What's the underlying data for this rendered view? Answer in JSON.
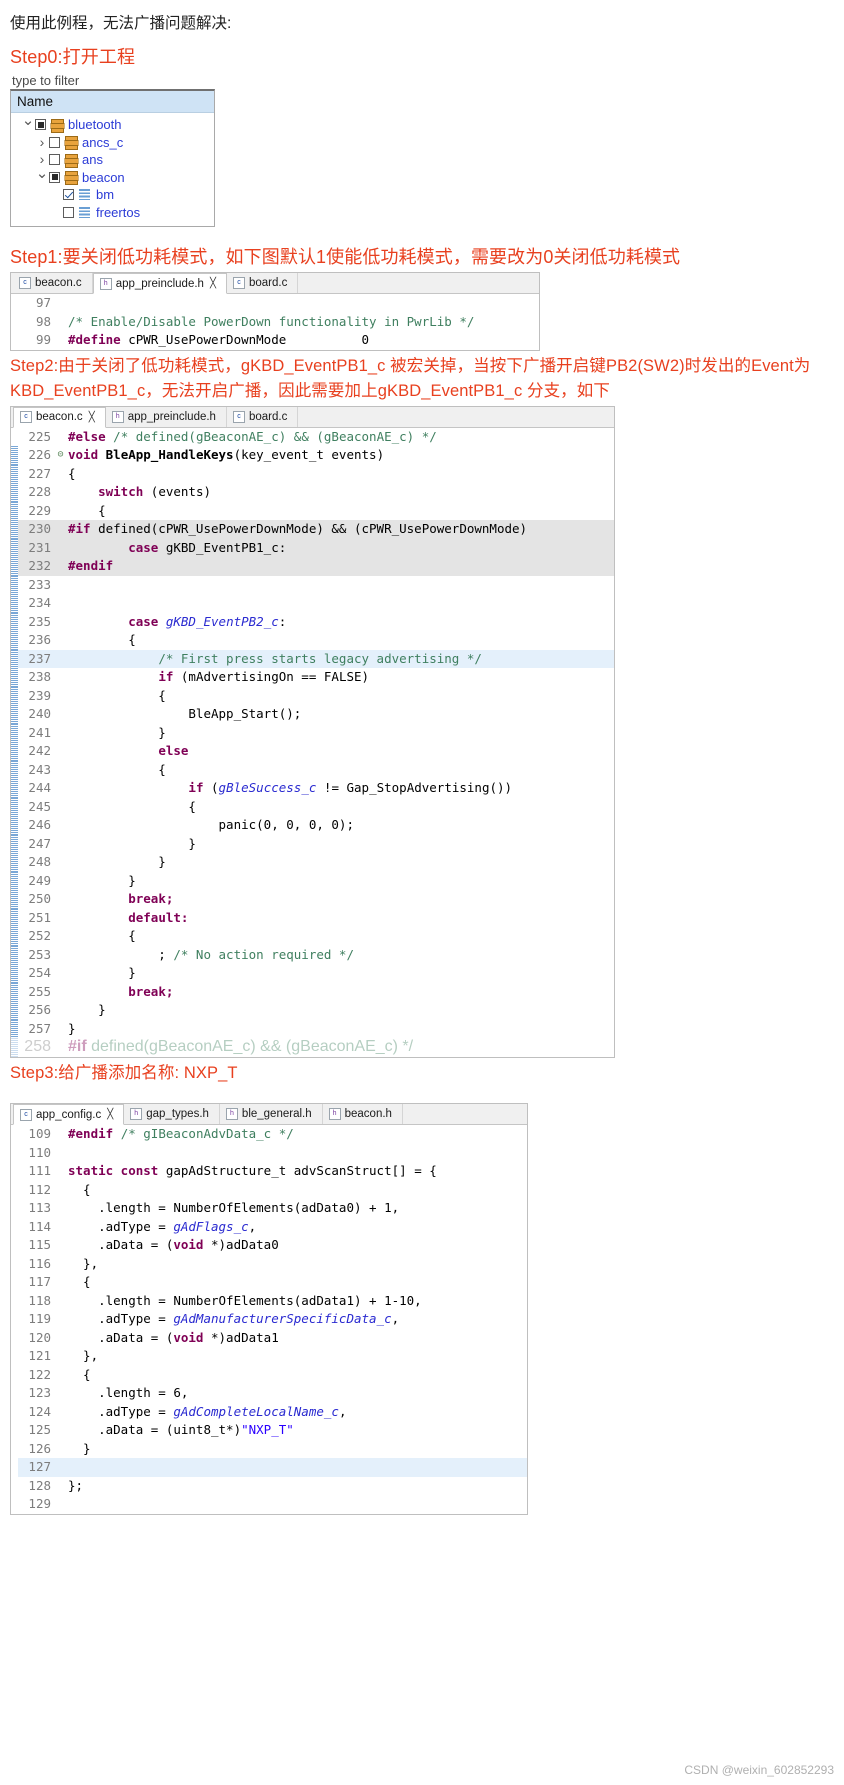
{
  "intro": "使用此例程，无法广播问题解决:",
  "steps": {
    "step0": "Step0:打开工程",
    "step1": "Step1:要关闭低功耗模式，如下图默认1使能低功耗模式，需要改为0关闭低功耗模式",
    "step2_line1": "Step2:由于关闭了低功耗模式，gKBD_EventPB1_c 被宏关掉，当按下广播开启键PB2(SW2)时发出的Event为",
    "step2_line2": "KBD_EventPB1_c，无法开启广播，因此需要加上gKBD_EventPB1_c 分支，如下",
    "step3": "Step3:给广播添加名称: NXP_T"
  },
  "project_tree": {
    "filter_placeholder": "type to filter",
    "column_header": "Name",
    "items": [
      {
        "label": "bluetooth",
        "indent": 0,
        "arrow": "down",
        "check": "filled",
        "icon": "project-icon"
      },
      {
        "label": "ancs_c",
        "indent": 1,
        "arrow": "right",
        "check": "empty",
        "icon": "project-icon"
      },
      {
        "label": "ans",
        "indent": 1,
        "arrow": "right",
        "check": "empty",
        "icon": "project-icon"
      },
      {
        "label": "beacon",
        "indent": 1,
        "arrow": "down",
        "check": "filled",
        "icon": "project-icon"
      },
      {
        "label": "bm",
        "indent": 2,
        "arrow": "none",
        "check": "checked",
        "icon": "file-icon"
      },
      {
        "label": "freertos",
        "indent": 2,
        "arrow": "none",
        "check": "empty",
        "icon": "file-icon"
      }
    ]
  },
  "editor1": {
    "tabs": [
      {
        "label": "beacon.c",
        "icon": "c-file-icon",
        "active": false,
        "closable": false
      },
      {
        "label": "app_preinclude.h",
        "icon": "h-file-icon",
        "active": true,
        "closable": true
      },
      {
        "label": "board.c",
        "icon": "c-file-icon",
        "active": false,
        "closable": false
      }
    ],
    "lines": [
      {
        "no": "97",
        "fold": "",
        "hl": "",
        "tokens": []
      },
      {
        "no": "98",
        "fold": "",
        "hl": "",
        "tokens": [
          {
            "t": "/* Enable/Disable PowerDown functionality in PwrLib */",
            "c": "cmt"
          }
        ]
      },
      {
        "no": "99",
        "fold": "",
        "hl": "",
        "tokens": [
          {
            "t": "#define",
            "c": "pp"
          },
          {
            "t": " cPWR_UsePowerDownMode          0",
            "c": "plain"
          }
        ]
      }
    ]
  },
  "editor2": {
    "tabs": [
      {
        "label": "beacon.c",
        "icon": "c-file-icon",
        "active": true,
        "closable": true
      },
      {
        "label": "app_preinclude.h",
        "icon": "h-file-icon",
        "active": false,
        "closable": false
      },
      {
        "label": "board.c",
        "icon": "c-file-icon",
        "active": false,
        "closable": false
      }
    ],
    "lines": [
      {
        "no": "225",
        "fold": "",
        "hl": "",
        "marked": false,
        "tokens": [
          {
            "t": "#else",
            "c": "pp"
          },
          {
            "t": " ",
            "c": "plain"
          },
          {
            "t": "/* defined(gBeaconAE_c) && (gBeaconAE_c) */",
            "c": "cmt"
          }
        ]
      },
      {
        "no": "226",
        "fold": "-",
        "hl": "",
        "marked": true,
        "tokens": [
          {
            "t": "void ",
            "c": "kw"
          },
          {
            "t": "BleApp_HandleKeys",
            "c": "fn"
          },
          {
            "t": "(key_event_t events)",
            "c": "plain"
          }
        ]
      },
      {
        "no": "227",
        "fold": "",
        "hl": "",
        "marked": true,
        "tokens": [
          {
            "t": "{",
            "c": "plain"
          }
        ]
      },
      {
        "no": "228",
        "fold": "",
        "hl": "",
        "marked": true,
        "tokens": [
          {
            "t": "    ",
            "c": "plain"
          },
          {
            "t": "switch",
            "c": "kw"
          },
          {
            "t": " (events)",
            "c": "plain"
          }
        ]
      },
      {
        "no": "229",
        "fold": "",
        "hl": "",
        "marked": true,
        "tokens": [
          {
            "t": "    {",
            "c": "plain"
          }
        ]
      },
      {
        "no": "230",
        "fold": "",
        "hl": "hl-grey",
        "marked": true,
        "tokens": [
          {
            "t": "#if",
            "c": "pp"
          },
          {
            "t": " defined(cPWR_UsePowerDownMode) && (cPWR_UsePowerDownMode)",
            "c": "plain"
          }
        ]
      },
      {
        "no": "231",
        "fold": "",
        "hl": "hl-grey",
        "marked": true,
        "tokens": [
          {
            "t": "        ",
            "c": "plain"
          },
          {
            "t": "case",
            "c": "kw"
          },
          {
            "t": " gKBD_EventPB1_c:",
            "c": "plain"
          }
        ]
      },
      {
        "no": "232",
        "fold": "",
        "hl": "hl-grey",
        "marked": true,
        "tokens": [
          {
            "t": "#endif",
            "c": "pp"
          }
        ]
      },
      {
        "no": "233",
        "fold": "",
        "hl": "",
        "marked": true,
        "tokens": []
      },
      {
        "no": "234",
        "fold": "",
        "hl": "",
        "marked": true,
        "tokens": []
      },
      {
        "no": "235",
        "fold": "",
        "hl": "",
        "marked": true,
        "tokens": [
          {
            "t": "        ",
            "c": "plain"
          },
          {
            "t": "case",
            "c": "kw"
          },
          {
            "t": " ",
            "c": "plain"
          },
          {
            "t": "gKBD_EventPB2_c",
            "c": "ital"
          },
          {
            "t": ":",
            "c": "plain"
          }
        ]
      },
      {
        "no": "236",
        "fold": "",
        "hl": "",
        "marked": true,
        "tokens": [
          {
            "t": "        {",
            "c": "plain"
          }
        ]
      },
      {
        "no": "237",
        "fold": "",
        "hl": "hl-blue",
        "marked": true,
        "tokens": [
          {
            "t": "            ",
            "c": "plain"
          },
          {
            "t": "/* First press starts legacy advertising */",
            "c": "cmt"
          }
        ]
      },
      {
        "no": "238",
        "fold": "",
        "hl": "",
        "marked": true,
        "tokens": [
          {
            "t": "            ",
            "c": "plain"
          },
          {
            "t": "if",
            "c": "kw"
          },
          {
            "t": " (mAdvertisingOn == FALSE)",
            "c": "plain"
          }
        ]
      },
      {
        "no": "239",
        "fold": "",
        "hl": "",
        "marked": true,
        "tokens": [
          {
            "t": "            {",
            "c": "plain"
          }
        ]
      },
      {
        "no": "240",
        "fold": "",
        "hl": "",
        "marked": true,
        "tokens": [
          {
            "t": "                BleApp_Start();",
            "c": "plain"
          }
        ]
      },
      {
        "no": "241",
        "fold": "",
        "hl": "",
        "marked": true,
        "tokens": [
          {
            "t": "            }",
            "c": "plain"
          }
        ]
      },
      {
        "no": "242",
        "fold": "",
        "hl": "",
        "marked": true,
        "tokens": [
          {
            "t": "            ",
            "c": "plain"
          },
          {
            "t": "else",
            "c": "kw"
          }
        ]
      },
      {
        "no": "243",
        "fold": "",
        "hl": "",
        "marked": true,
        "tokens": [
          {
            "t": "            {",
            "c": "plain"
          }
        ]
      },
      {
        "no": "244",
        "fold": "",
        "hl": "",
        "marked": true,
        "tokens": [
          {
            "t": "                ",
            "c": "plain"
          },
          {
            "t": "if",
            "c": "kw"
          },
          {
            "t": " (",
            "c": "plain"
          },
          {
            "t": "gBleSuccess_c",
            "c": "ital"
          },
          {
            "t": " != Gap_StopAdvertising())",
            "c": "plain"
          }
        ]
      },
      {
        "no": "245",
        "fold": "",
        "hl": "",
        "marked": true,
        "tokens": [
          {
            "t": "                {",
            "c": "plain"
          }
        ]
      },
      {
        "no": "246",
        "fold": "",
        "hl": "",
        "marked": true,
        "tokens": [
          {
            "t": "                    panic(0, 0, 0, 0);",
            "c": "plain"
          }
        ]
      },
      {
        "no": "247",
        "fold": "",
        "hl": "",
        "marked": true,
        "tokens": [
          {
            "t": "                }",
            "c": "plain"
          }
        ]
      },
      {
        "no": "248",
        "fold": "",
        "hl": "",
        "marked": true,
        "tokens": [
          {
            "t": "            }",
            "c": "plain"
          }
        ]
      },
      {
        "no": "249",
        "fold": "",
        "hl": "",
        "marked": true,
        "tokens": [
          {
            "t": "        }",
            "c": "plain"
          }
        ]
      },
      {
        "no": "250",
        "fold": "",
        "hl": "",
        "marked": true,
        "tokens": [
          {
            "t": "        ",
            "c": "plain"
          },
          {
            "t": "break;",
            "c": "kw"
          }
        ]
      },
      {
        "no": "251",
        "fold": "",
        "hl": "",
        "marked": true,
        "tokens": [
          {
            "t": "        ",
            "c": "plain"
          },
          {
            "t": "default:",
            "c": "kw"
          }
        ]
      },
      {
        "no": "252",
        "fold": "",
        "hl": "",
        "marked": true,
        "tokens": [
          {
            "t": "        {",
            "c": "plain"
          }
        ]
      },
      {
        "no": "253",
        "fold": "",
        "hl": "",
        "marked": true,
        "tokens": [
          {
            "t": "            ; ",
            "c": "plain"
          },
          {
            "t": "/* No action required */",
            "c": "cmt"
          }
        ]
      },
      {
        "no": "254",
        "fold": "",
        "hl": "",
        "marked": true,
        "tokens": [
          {
            "t": "        }",
            "c": "plain"
          }
        ]
      },
      {
        "no": "255",
        "fold": "",
        "hl": "",
        "marked": true,
        "tokens": [
          {
            "t": "        ",
            "c": "plain"
          },
          {
            "t": "break;",
            "c": "kw"
          }
        ]
      },
      {
        "no": "256",
        "fold": "",
        "hl": "",
        "marked": true,
        "tokens": [
          {
            "t": "    }",
            "c": "plain"
          }
        ]
      },
      {
        "no": "257",
        "fold": "",
        "hl": "",
        "marked": true,
        "tokens": [
          {
            "t": "}",
            "c": "plain"
          }
        ]
      }
    ]
  },
  "editor3": {
    "tabs": [
      {
        "label": "app_config.c",
        "icon": "c-file-icon",
        "active": true,
        "closable": true
      },
      {
        "label": "gap_types.h",
        "icon": "h-file-icon",
        "active": false,
        "closable": false
      },
      {
        "label": "ble_general.h",
        "icon": "h-file-icon",
        "active": false,
        "closable": false
      },
      {
        "label": "beacon.h",
        "icon": "h-file-icon",
        "active": false,
        "closable": false
      }
    ],
    "lines": [
      {
        "no": "109",
        "fold": "",
        "hl": "",
        "tokens": [
          {
            "t": "#endif",
            "c": "pp"
          },
          {
            "t": " ",
            "c": "plain"
          },
          {
            "t": "/* gIBeaconAdvData_c */",
            "c": "cmt"
          }
        ]
      },
      {
        "no": "110",
        "fold": "",
        "hl": "",
        "tokens": []
      },
      {
        "no": "111",
        "fold": "",
        "hl": "",
        "tokens": [
          {
            "t": "static const ",
            "c": "kw"
          },
          {
            "t": "gapAdStructure_t advScanStruct[] = {",
            "c": "plain"
          }
        ]
      },
      {
        "no": "112",
        "fold": "",
        "hl": "",
        "tokens": [
          {
            "t": "  {",
            "c": "plain"
          }
        ]
      },
      {
        "no": "113",
        "fold": "",
        "hl": "",
        "tokens": [
          {
            "t": "    .length = NumberOfElements(adData0) + 1,",
            "c": "plain"
          }
        ]
      },
      {
        "no": "114",
        "fold": "",
        "hl": "",
        "tokens": [
          {
            "t": "    .adType = ",
            "c": "plain"
          },
          {
            "t": "gAdFlags_c",
            "c": "ital"
          },
          {
            "t": ",",
            "c": "plain"
          }
        ]
      },
      {
        "no": "115",
        "fold": "",
        "hl": "",
        "tokens": [
          {
            "t": "    .aData = (",
            "c": "plain"
          },
          {
            "t": "void",
            "c": "kw"
          },
          {
            "t": " *)adData0",
            "c": "plain"
          }
        ]
      },
      {
        "no": "116",
        "fold": "",
        "hl": "",
        "tokens": [
          {
            "t": "  },",
            "c": "plain"
          }
        ]
      },
      {
        "no": "117",
        "fold": "",
        "hl": "",
        "tokens": [
          {
            "t": "  {",
            "c": "plain"
          }
        ]
      },
      {
        "no": "118",
        "fold": "",
        "hl": "",
        "tokens": [
          {
            "t": "    .length = NumberOfElements(adData1) + 1-10,",
            "c": "plain"
          }
        ]
      },
      {
        "no": "119",
        "fold": "",
        "hl": "",
        "tokens": [
          {
            "t": "    .adType = ",
            "c": "plain"
          },
          {
            "t": "gAdManufacturerSpecificData_c",
            "c": "ital"
          },
          {
            "t": ",",
            "c": "plain"
          }
        ]
      },
      {
        "no": "120",
        "fold": "",
        "hl": "",
        "tokens": [
          {
            "t": "    .aData = (",
            "c": "plain"
          },
          {
            "t": "void",
            "c": "kw"
          },
          {
            "t": " *)adData1",
            "c": "plain"
          }
        ]
      },
      {
        "no": "121",
        "fold": "",
        "hl": "",
        "tokens": [
          {
            "t": "  },",
            "c": "plain"
          }
        ]
      },
      {
        "no": "122",
        "fold": "",
        "hl": "",
        "tokens": [
          {
            "t": "  {",
            "c": "plain"
          }
        ]
      },
      {
        "no": "123",
        "fold": "",
        "hl": "",
        "tokens": [
          {
            "t": "    .length = 6,",
            "c": "plain"
          }
        ]
      },
      {
        "no": "124",
        "fold": "",
        "hl": "",
        "tokens": [
          {
            "t": "    .adType = ",
            "c": "plain"
          },
          {
            "t": "gAdCompleteLocalName_c",
            "c": "ital"
          },
          {
            "t": ",",
            "c": "plain"
          }
        ]
      },
      {
        "no": "125",
        "fold": "",
        "hl": "",
        "tokens": [
          {
            "t": "    .aData = (uint8_t*)",
            "c": "plain"
          },
          {
            "t": "\"NXP_T\"",
            "c": "str"
          }
        ]
      },
      {
        "no": "126",
        "fold": "",
        "hl": "",
        "tokens": [
          {
            "t": "  }",
            "c": "plain"
          }
        ]
      },
      {
        "no": "127",
        "fold": "",
        "hl": "hl-blue",
        "tokens": []
      },
      {
        "no": "128",
        "fold": "",
        "hl": "",
        "tokens": [
          {
            "t": "};",
            "c": "plain"
          }
        ]
      },
      {
        "no": "129",
        "fold": "",
        "hl": "",
        "tokens": []
      }
    ]
  },
  "watermark": "CSDN @weixin_602852293"
}
